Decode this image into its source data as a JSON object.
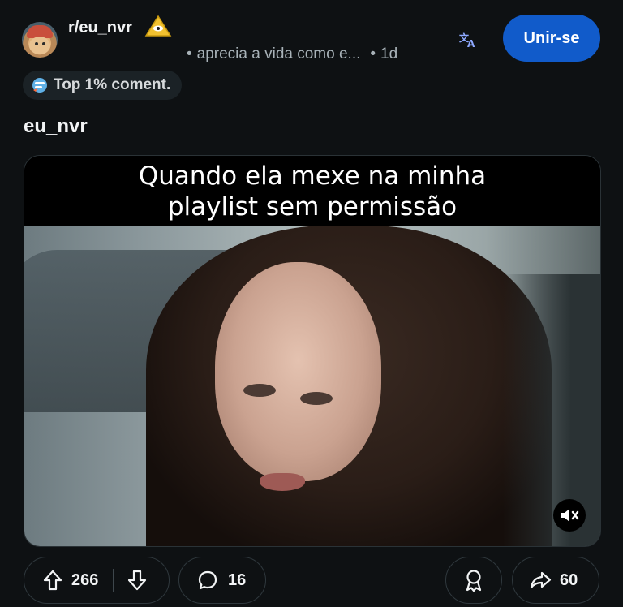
{
  "header": {
    "subreddit": "r/eu_nvr",
    "meta_text": "aprecia a vida como e...",
    "age": "1d",
    "join_label": "Unir-se"
  },
  "badge": {
    "label": "Top 1% coment."
  },
  "post": {
    "author": "eu_nvr",
    "media_caption_line1": "Quando ela mexe na minha",
    "media_caption_line2": "playlist sem permissão"
  },
  "actions": {
    "upvotes": "266",
    "comments": "16",
    "shares": "60"
  },
  "icons": {
    "translate": "translate-icon",
    "upvote": "upvote-arrow-icon",
    "downvote": "downvote-arrow-icon",
    "comment": "comment-bubble-icon",
    "award": "award-icon",
    "share": "share-arrow-icon",
    "mute": "speaker-muted-icon"
  },
  "colors": {
    "background": "#0e1113",
    "join_button": "#115bca",
    "translate": "#8ea9ff",
    "meta_text": "#a8b2b8"
  }
}
